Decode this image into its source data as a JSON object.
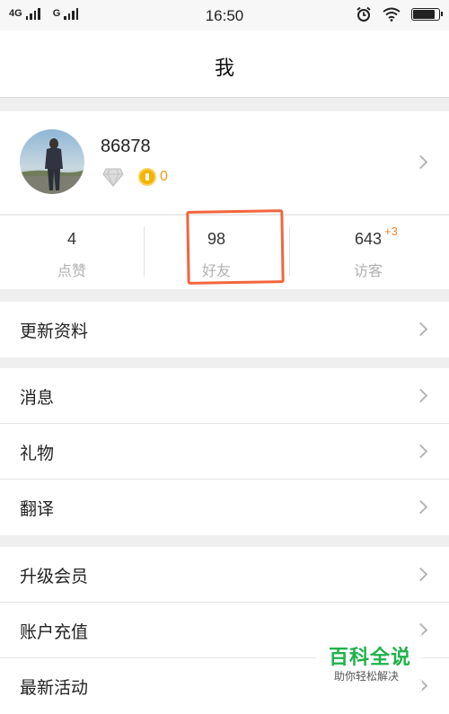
{
  "status_bar": {
    "network_1": "4G",
    "network_2": "G",
    "time": "16:50",
    "battery_level": 0.9,
    "icons": [
      "signal-icon",
      "alarm-icon",
      "wifi-icon",
      "battery-icon"
    ]
  },
  "header": {
    "title": "我"
  },
  "profile": {
    "username": "86878",
    "coin_count": "0",
    "icons": [
      "avatar",
      "diamond-icon",
      "coin-icon",
      "chevron-right-icon"
    ]
  },
  "stats": [
    {
      "value": "4",
      "label": "点赞"
    },
    {
      "value": "98",
      "label": "好友"
    },
    {
      "value": "643",
      "label": "访客",
      "badge": "+3"
    }
  ],
  "menu": {
    "group1": [
      {
        "label": "更新资料"
      }
    ],
    "group2": [
      {
        "label": "消息"
      },
      {
        "label": "礼物"
      },
      {
        "label": "翻译"
      }
    ],
    "group3": [
      {
        "label": "升级会员"
      },
      {
        "label": "账户充值"
      },
      {
        "label": "最新活动"
      }
    ]
  },
  "watermark": {
    "title": "百科全说",
    "subtitle": "助你轻松解决"
  },
  "colors": {
    "accent": "#f39c12",
    "highlight": "#f2653b",
    "watermark_green": "#1fb24a"
  }
}
